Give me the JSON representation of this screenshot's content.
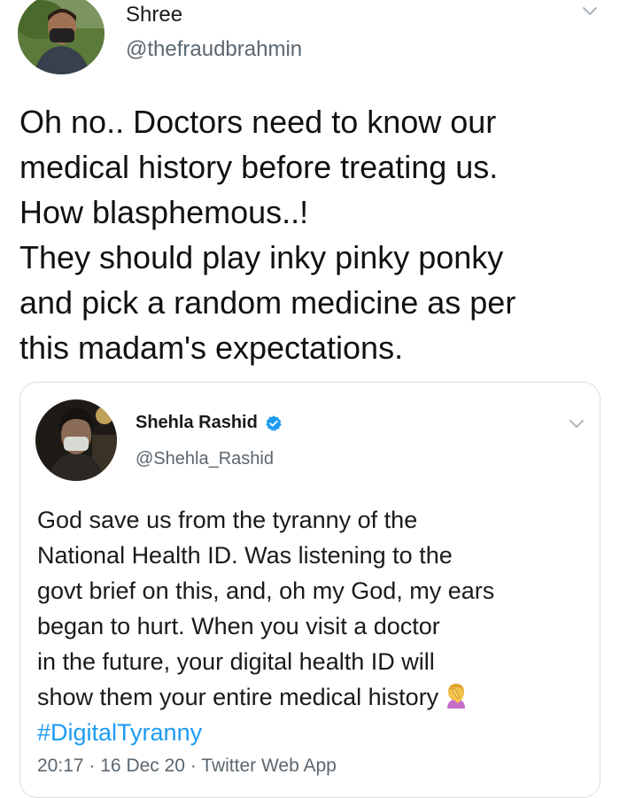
{
  "outer_tweet": {
    "display_name": "Shree",
    "handle": "@thefraudbrahmin",
    "text_lines": [
      "Oh no.. Doctors need to know our",
      "medical history before treating us.",
      "How blasphemous..!",
      "They should play inky pinky ponky",
      "and pick a random medicine as per",
      "this madam's expectations."
    ]
  },
  "quoted_tweet": {
    "display_name": "Shehla Rashid",
    "handle": "@Shehla_Rashid",
    "text_lines": [
      "God save us from the tyranny of the",
      "National Health ID. Was listening to the",
      "govt brief on this, and, oh my God, my ears",
      "began to hurt. When you visit a doctor",
      "in the future, your digital health ID will",
      "show them your entire medical history"
    ],
    "hashtag": "#DigitalTyranny",
    "time": "20:17",
    "date": "16 Dec 20",
    "source": "Twitter Web App",
    "separator": "·"
  },
  "icons": {
    "chevron": "chevron-down-icon",
    "verified": "verified-badge-icon",
    "emoji": "woman-facepalming-emoji"
  },
  "colors": {
    "link": "#1d9bf0",
    "secondary_text": "#5b6770",
    "verified": "#1d9bf0"
  }
}
